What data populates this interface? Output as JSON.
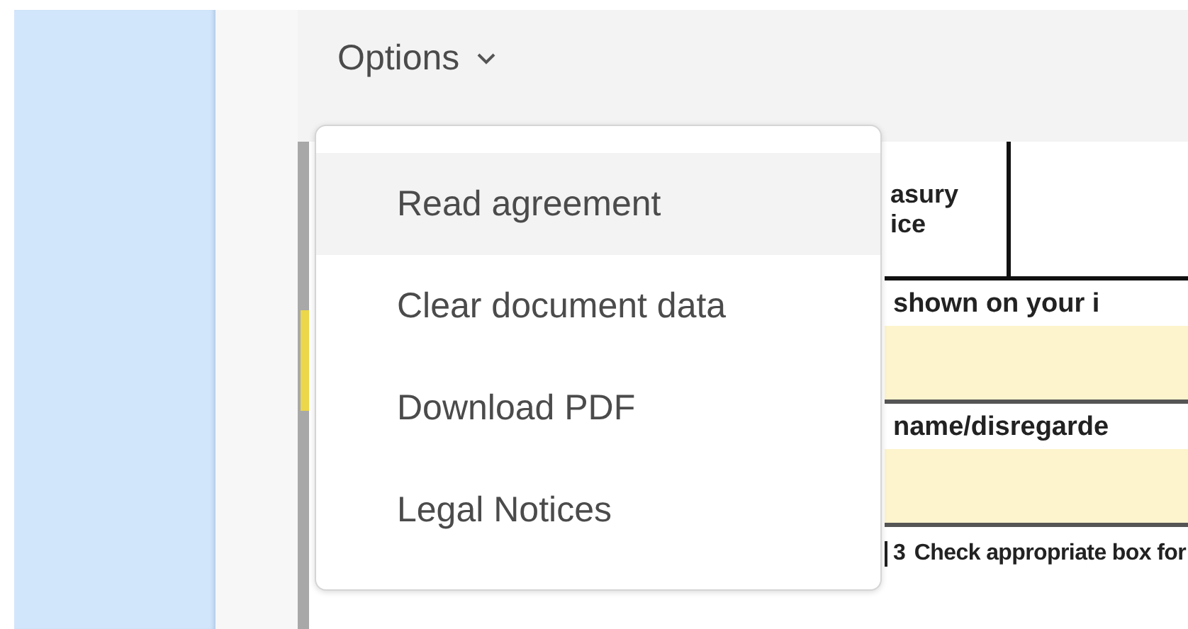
{
  "toolbar": {
    "options_label": "Options"
  },
  "document": {
    "header_text": [
      "asury",
      "ice"
    ],
    "line_1_label": "shown on your i",
    "line_2_label": "name/disregarde",
    "line_3_number": "3",
    "line_3_label": "Check appropriate box for"
  },
  "menu": {
    "items": [
      {
        "label": "Read agreement",
        "selected": true
      },
      {
        "label": "Clear document data",
        "selected": false
      },
      {
        "label": "Download PDF",
        "selected": false
      },
      {
        "label": "Legal Notices",
        "selected": false
      }
    ]
  }
}
